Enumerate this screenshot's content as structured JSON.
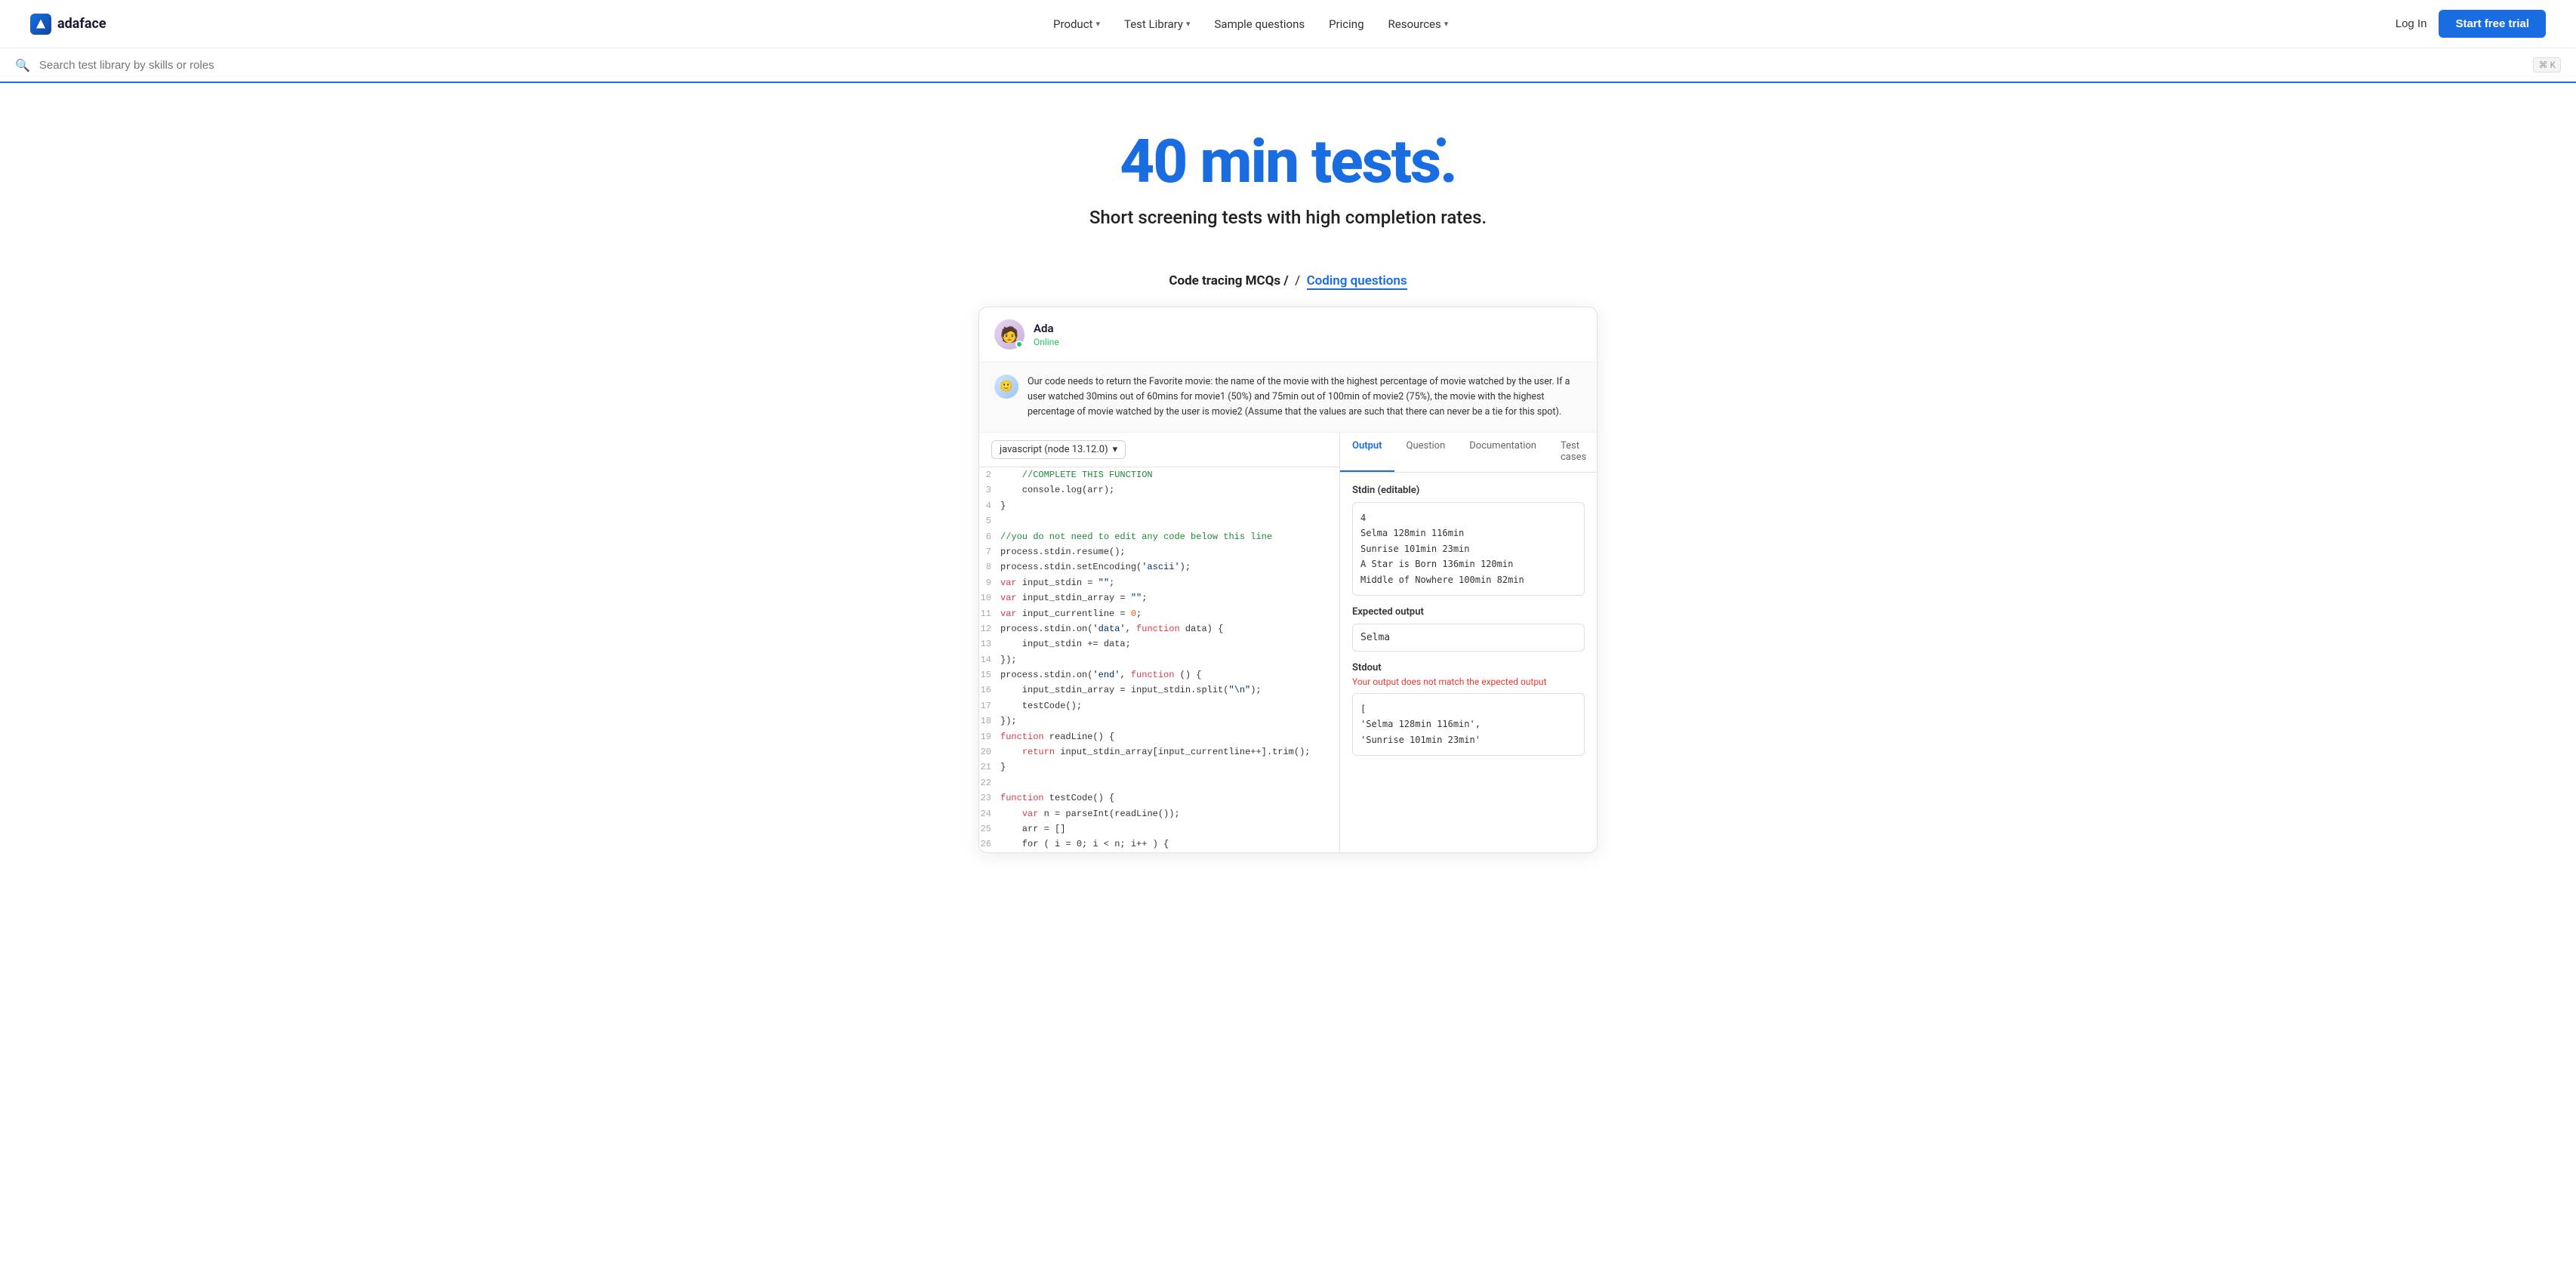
{
  "brand": {
    "name": "adaface"
  },
  "nav": {
    "links": [
      {
        "label": "Product",
        "hasDropdown": true
      },
      {
        "label": "Test Library",
        "hasDropdown": true
      },
      {
        "label": "Sample questions",
        "hasDropdown": false
      },
      {
        "label": "Pricing",
        "hasDropdown": false
      },
      {
        "label": "Resources",
        "hasDropdown": true
      }
    ],
    "login_label": "Log In",
    "trial_label": "Start free trial"
  },
  "search": {
    "placeholder": "Search test library by skills or roles",
    "shortcut": "⌘ K"
  },
  "hero": {
    "title": "40 min tests.",
    "subtitle": "Short screening tests with high completion rates."
  },
  "demo": {
    "label_prefix": "Code tracing MCQs /",
    "label_link": "Coding questions",
    "card": {
      "ada_name": "Ada",
      "ada_status": "Online",
      "question_text": "Our code needs to return the Favorite movie: the name of the movie with the highest percentage of movie watched by the user. If a user watched 30mins out of 60mins for movie1 (50%) and 75min out of 100min of movie2 (75%), the movie with the highest percentage of movie watched by the user is movie2 (Assume that the values are such that there can never be a tie for this spot).",
      "language": "javascript (node 13.12.0)",
      "code_lines": [
        {
          "num": "2",
          "parts": [
            {
              "cls": "c-comment",
              "text": "    //COMPLETE THIS FUNCTION"
            }
          ]
        },
        {
          "num": "3",
          "parts": [
            {
              "cls": "",
              "text": "    console.log(arr);"
            }
          ]
        },
        {
          "num": "4",
          "parts": [
            {
              "cls": "",
              "text": "}"
            }
          ]
        },
        {
          "num": "5",
          "parts": [
            {
              "cls": "",
              "text": ""
            }
          ]
        },
        {
          "num": "6",
          "parts": [
            {
              "cls": "c-comment",
              "text": "//you do not need to edit any code below this line"
            }
          ]
        },
        {
          "num": "7",
          "parts": [
            {
              "cls": "",
              "text": "process.stdin.resume();"
            }
          ]
        },
        {
          "num": "8",
          "parts": [
            {
              "cls": "",
              "text": "process.stdin.setEncoding("
            },
            {
              "cls": "c-string",
              "text": "'ascii'"
            },
            {
              "cls": "",
              "text": ");"
            }
          ]
        },
        {
          "num": "9",
          "parts": [
            {
              "cls": "c-keyword",
              "text": "var"
            },
            {
              "cls": "",
              "text": " input_stdin = "
            },
            {
              "cls": "c-string",
              "text": "\"\""
            },
            {
              "cls": "",
              "text": ";"
            }
          ]
        },
        {
          "num": "10",
          "parts": [
            {
              "cls": "c-keyword",
              "text": "var"
            },
            {
              "cls": "",
              "text": " input_stdin_array = "
            },
            {
              "cls": "c-string",
              "text": "\"\""
            },
            {
              "cls": "",
              "text": ";"
            }
          ]
        },
        {
          "num": "11",
          "parts": [
            {
              "cls": "c-keyword",
              "text": "var"
            },
            {
              "cls": "",
              "text": " input_currentline = "
            },
            {
              "cls": "c-num",
              "text": "0"
            },
            {
              "cls": "",
              "text": ";"
            }
          ]
        },
        {
          "num": "12",
          "parts": [
            {
              "cls": "",
              "text": "process.stdin.on("
            },
            {
              "cls": "c-string",
              "text": "'data'"
            },
            {
              "cls": "",
              "text": ", "
            },
            {
              "cls": "c-keyword",
              "text": "function"
            },
            {
              "cls": "",
              "text": " data) {"
            }
          ]
        },
        {
          "num": "13",
          "parts": [
            {
              "cls": "",
              "text": "    input_stdin += data;"
            }
          ]
        },
        {
          "num": "14",
          "parts": [
            {
              "cls": "",
              "text": "});"
            }
          ]
        },
        {
          "num": "15",
          "parts": [
            {
              "cls": "",
              "text": "process.stdin.on("
            },
            {
              "cls": "c-string",
              "text": "'end'"
            },
            {
              "cls": "",
              "text": ", "
            },
            {
              "cls": "c-keyword",
              "text": "function"
            },
            {
              "cls": "",
              "text": " () {"
            }
          ]
        },
        {
          "num": "16",
          "parts": [
            {
              "cls": "",
              "text": "    input_stdin_array = input_stdin.split("
            },
            {
              "cls": "c-string",
              "text": "\"\\n\""
            },
            {
              "cls": "",
              "text": ");"
            }
          ]
        },
        {
          "num": "17",
          "parts": [
            {
              "cls": "",
              "text": "    testCode();"
            }
          ]
        },
        {
          "num": "18",
          "parts": [
            {
              "cls": "",
              "text": "});"
            }
          ]
        },
        {
          "num": "19",
          "parts": [
            {
              "cls": "c-keyword",
              "text": "function"
            },
            {
              "cls": "",
              "text": " readLine() {"
            }
          ]
        },
        {
          "num": "20",
          "parts": [
            {
              "cls": "",
              "text": "    "
            },
            {
              "cls": "c-keyword",
              "text": "return"
            },
            {
              "cls": "",
              "text": " input_stdin_array[input_currentline++].trim();"
            }
          ]
        },
        {
          "num": "21",
          "parts": [
            {
              "cls": "",
              "text": "}"
            }
          ]
        },
        {
          "num": "22",
          "parts": [
            {
              "cls": "",
              "text": ""
            }
          ]
        },
        {
          "num": "23",
          "parts": [
            {
              "cls": "c-keyword",
              "text": "function"
            },
            {
              "cls": "",
              "text": " testCode() {"
            }
          ]
        },
        {
          "num": "24",
          "parts": [
            {
              "cls": "",
              "text": "    "
            },
            {
              "cls": "c-keyword",
              "text": "var"
            },
            {
              "cls": "",
              "text": " n = parseInt(readLine());"
            }
          ]
        },
        {
          "num": "25",
          "parts": [
            {
              "cls": "",
              "text": "    arr = []"
            }
          ]
        },
        {
          "num": "26",
          "parts": [
            {
              "cls": "",
              "text": "    for ( i = 0; i < n; i++ ) {"
            }
          ]
        }
      ],
      "output_tabs": [
        "Output",
        "Question",
        "Documentation",
        "Test cases"
      ],
      "active_tab": "Output",
      "stdin_label": "Stdin (editable)",
      "stdin_lines": [
        "4",
        "Selma 128min 116min",
        "Sunrise 101min 23min",
        "A Star is Born 136min 120min",
        "Middle of Nowhere 100min 82min"
      ],
      "expected_label": "Expected output",
      "expected_value": "Selma",
      "stdout_label": "Stdout",
      "stdout_error": "Your output does not match the expected output",
      "stdout_lines": [
        "[",
        "  'Selma 128min 116min',",
        "  'Sunrise 101min 23min'"
      ]
    }
  }
}
